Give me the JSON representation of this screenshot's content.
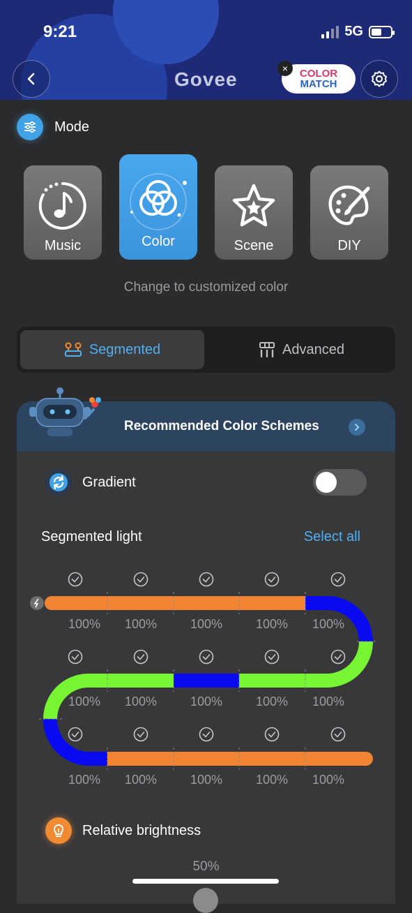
{
  "status_bar": {
    "time": "9:21",
    "network": "5G"
  },
  "header": {
    "logo": "Govee",
    "badge_line1": "COLOR",
    "badge_line2": "MATCH"
  },
  "mode": {
    "title": "Mode",
    "cards": [
      {
        "label": "Music",
        "icon": "music-note-icon",
        "active": false
      },
      {
        "label": "Color",
        "icon": "color-circles-icon",
        "active": true
      },
      {
        "label": "Scene",
        "icon": "star-icon",
        "active": false
      },
      {
        "label": "DIY",
        "icon": "palette-brush-icon",
        "active": false
      }
    ],
    "hint": "Change to customized color"
  },
  "tabs": [
    {
      "label": "Segmented",
      "active": true
    },
    {
      "label": "Advanced",
      "active": false
    }
  ],
  "panel": {
    "recommended": "Recommended Color Schemes",
    "gradient_label": "Gradient",
    "gradient_on": false,
    "segmented_label": "Segmented light",
    "select_all": "Select all",
    "rows": [
      {
        "segments": [
          {
            "color": "#f08433",
            "brightness": "100%"
          },
          {
            "color": "#f08433",
            "brightness": "100%"
          },
          {
            "color": "#f08433",
            "brightness": "100%"
          },
          {
            "color": "#f08433",
            "brightness": "100%"
          },
          {
            "color": "#0a0af0",
            "brightness": "100%"
          }
        ]
      },
      {
        "segments": [
          {
            "color": "#77f533",
            "brightness": "100%"
          },
          {
            "color": "#77f533",
            "brightness": "100%"
          },
          {
            "color": "#0a0af0",
            "brightness": "100%"
          },
          {
            "color": "#77f533",
            "brightness": "100%"
          },
          {
            "color": "#77f533",
            "brightness": "100%"
          }
        ]
      },
      {
        "segments": [
          {
            "color": "#0a0af0",
            "brightness": "100%"
          },
          {
            "color": "#f08433",
            "brightness": "100%"
          },
          {
            "color": "#f08433",
            "brightness": "100%"
          },
          {
            "color": "#f08433",
            "brightness": "100%"
          },
          {
            "color": "#f08433",
            "brightness": "100%"
          }
        ]
      }
    ],
    "brightness_label": "Relative brightness",
    "brightness_value": "50%"
  },
  "colors": {
    "accent": "#4fb1f0",
    "orange": "#f08433",
    "green": "#77f533",
    "blue": "#0a0af0"
  }
}
